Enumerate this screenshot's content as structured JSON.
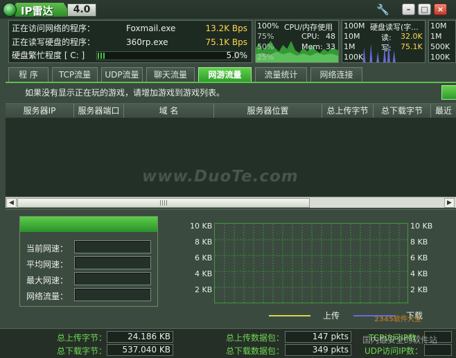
{
  "titlebar": {
    "title": "IP雷达",
    "version": "4.0",
    "icons": [
      "app-logo-icon",
      "wrench-icon",
      "minimize-icon",
      "maximize-icon",
      "close-icon"
    ]
  },
  "info": {
    "net_label": "正在访问网络的程序：",
    "net_proc": "Foxmail.exe",
    "net_rate": "13.2K Bps",
    "disk_label": "正在读写硬盘的程序：",
    "disk_proc": "360rp.exe",
    "disk_rate": "75.1K Bps",
    "busy_label": "硬盘繁忙程度 [ C: ]",
    "busy_pct": "5.0%",
    "busy_value": 0.05
  },
  "cpu_panel": {
    "header_pct": "100%",
    "header_title": "CPU/内存使用",
    "t75": "75%",
    "t50": "50%",
    "t25": "25%",
    "cpu_label": "CPU:",
    "cpu_val": "48",
    "mem_label": "Mem:",
    "mem_val": "33"
  },
  "disk_panel": {
    "t1": "100M",
    "title": "硬盘读写(字...",
    "t2": "10M",
    "read_label": "读:",
    "read_val": "32.0K",
    "t3": "1M",
    "write_label": "写:",
    "write_val": "75.1K",
    "t4": "100K"
  },
  "net_panel": {
    "t1": "10M",
    "t2": "1M",
    "t3": "500K",
    "t4": "100K"
  },
  "tabs": [
    {
      "label": "程  序"
    },
    {
      "label": "TCP流量"
    },
    {
      "label": "UDP流量"
    },
    {
      "label": "聊天流量"
    },
    {
      "label": "网游流量"
    },
    {
      "label": "流量统计"
    },
    {
      "label": "网络连接"
    }
  ],
  "active_tab": "网游流量",
  "notice": "如果没有显示正在玩的游戏，请增加游戏到游戏列表。",
  "table": {
    "columns": [
      "服务器IP",
      "服务器端口",
      "域  名",
      "服务器位置",
      "总上传字节",
      "总下载字节",
      "最近"
    ]
  },
  "stats": {
    "current_speed": "当前网速：",
    "avg_speed": "平均网速：",
    "max_speed": "最大网速：",
    "net_flow": "网络流量："
  },
  "graph": {
    "y_ticks": [
      "10 KB",
      "8 KB",
      "6 KB",
      "4 KB",
      "2 KB"
    ],
    "legend_up": "上传",
    "legend_down": "下载",
    "color_up": "#d8d84a",
    "color_down": "#6a6ad8"
  },
  "status": {
    "total_upload_label": "总上传字节：",
    "total_upload_val": "24.186 KB",
    "total_download_label": "总下载字节：",
    "total_download_val": "537.040 KB",
    "upload_pkts_label": "总上传数据包：",
    "upload_pkts_val": "147 pkts",
    "download_pkts_label": "总下载数据包：",
    "download_pkts_val": "349 pkts",
    "tcp_ip_label": "TCP访问IP数：",
    "udp_ip_label": "UDP访问IP数："
  },
  "watermarks": {
    "main": "www.DuoTe.com",
    "corner": "国内最安全的软件站",
    "corner2": "2345软件大全"
  },
  "colors": {
    "accent": "#3dbb3a",
    "rate_text": "#ffd84a",
    "status_label": "#6fd84e",
    "background": "#3b4a3f"
  }
}
